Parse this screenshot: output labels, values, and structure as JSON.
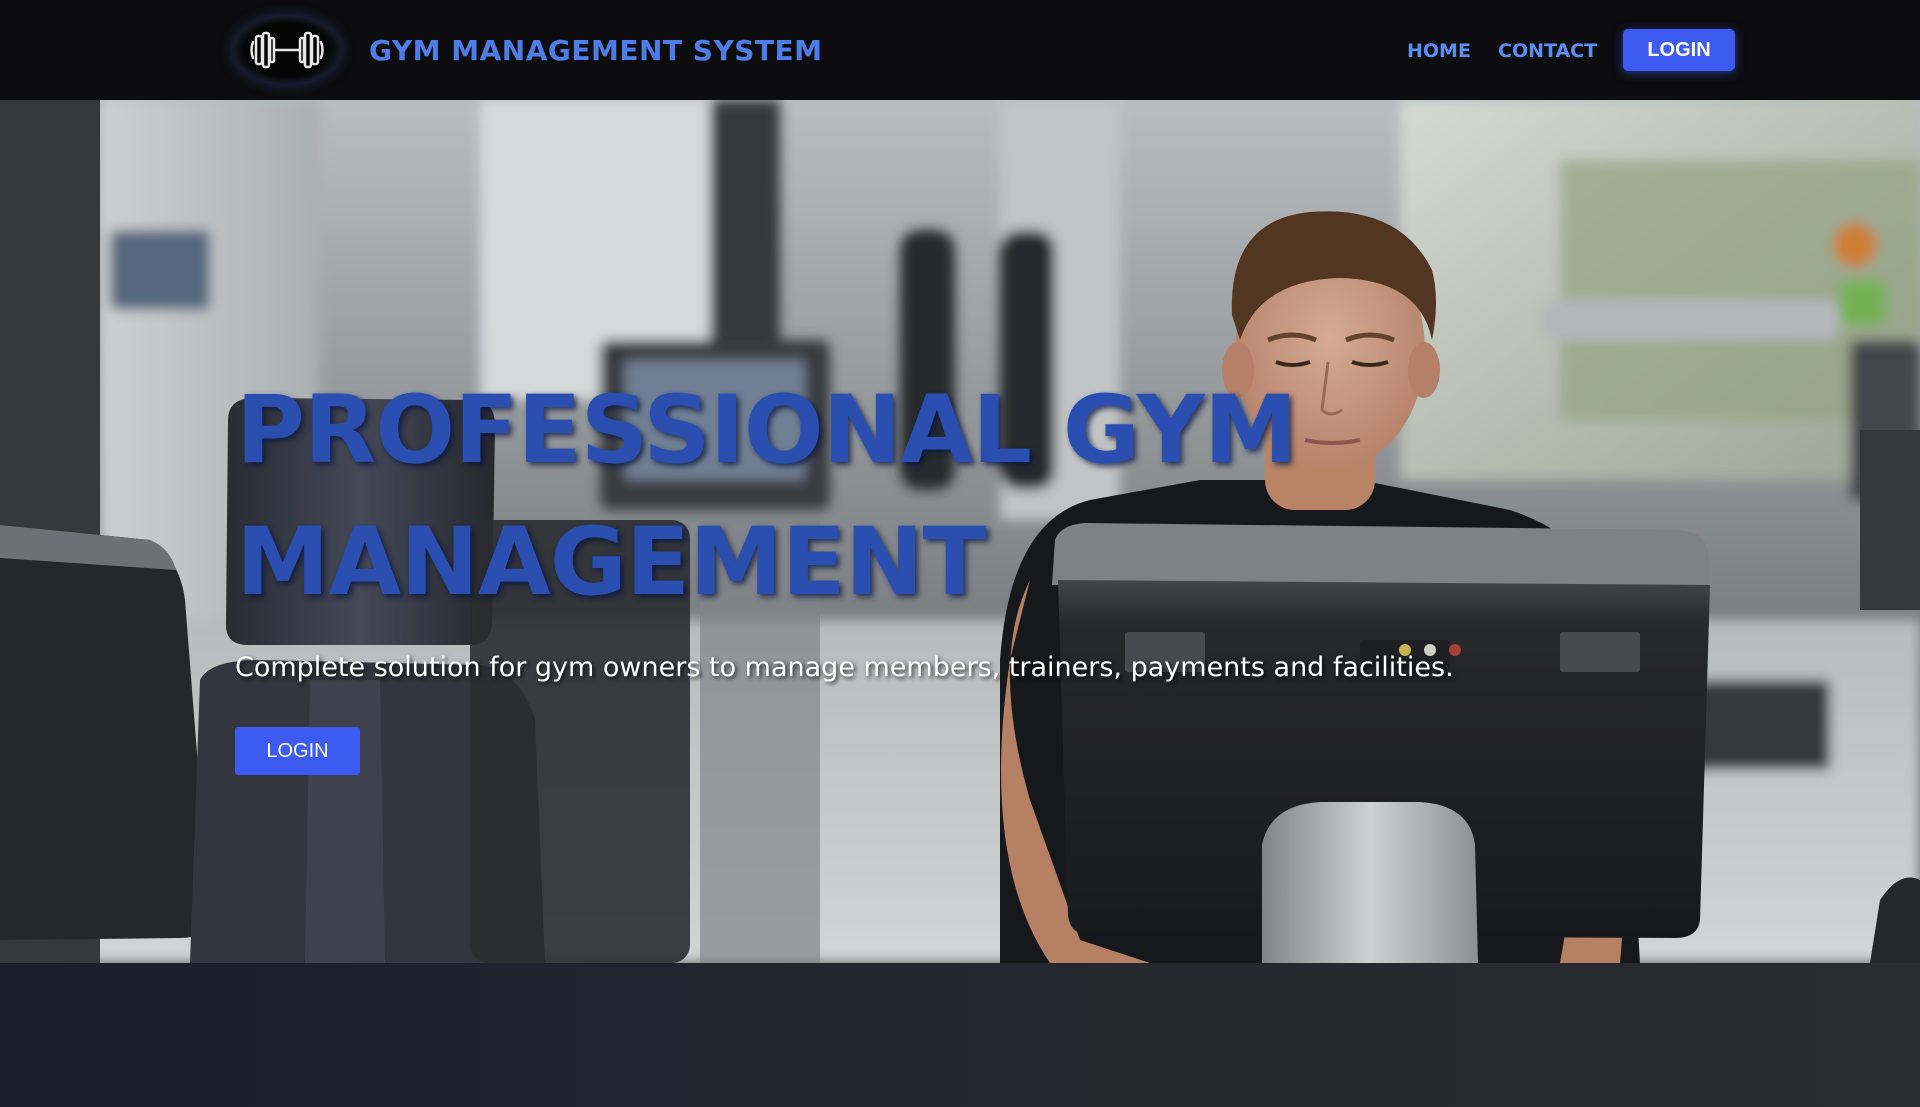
{
  "header": {
    "brand": "GYM MANAGEMENT SYSTEM",
    "logo_icon": "dumbbell-icon",
    "nav": {
      "home": "HOME",
      "contact": "CONTACT",
      "login": "LOGIN"
    }
  },
  "hero": {
    "title_line1": "PROFESSIONAL GYM",
    "title_line2": "MANAGEMENT",
    "subtitle": "Complete solution for gym owners to manage members, trainers, payments and facilities.",
    "cta_label": "LOGIN",
    "background": "photo of a young man on an exercise bike in a gym"
  },
  "colors": {
    "accent": "#3d5bf0",
    "brand_text": "#4f7de8",
    "nav_link": "#5b8ef2",
    "hero_title": "#2b4fb1",
    "navbar_bg": "#0d0d0f"
  }
}
